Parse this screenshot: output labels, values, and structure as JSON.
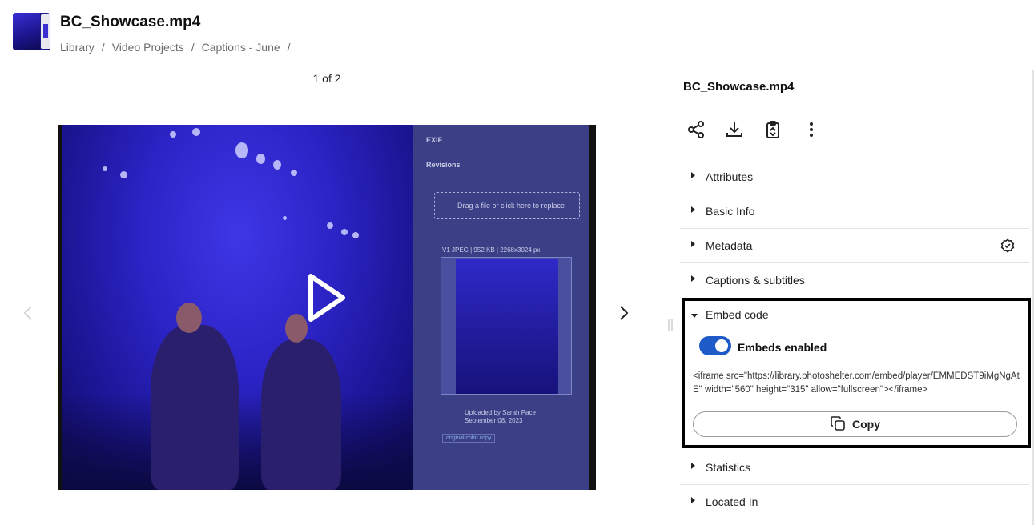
{
  "header": {
    "title": "BC_Showcase.mp4",
    "breadcrumb": [
      "Library",
      "Video Projects",
      "Captions - June"
    ],
    "separator": "/"
  },
  "viewer": {
    "counter": "1 of 2",
    "side_panel": {
      "exif": "EXIF",
      "revisions": "Revisions",
      "drop_text": "Drag a file or click here to replace",
      "version_meta": "V1  JPEG | 952 KB | 2268x3024 px",
      "uploaded_by": "Uploaded by Sarah Pace",
      "upload_date": "September 08, 2023",
      "tag": "original color copy"
    }
  },
  "panel": {
    "title": "BC_Showcase.mp4",
    "actions": [
      "share-icon",
      "download-icon",
      "clipboard-copy-icon",
      "more-vertical-icon"
    ],
    "sections": [
      "Attributes",
      "Basic Info",
      "Metadata",
      "Captions & subtitles"
    ],
    "embed": {
      "label": "Embed code",
      "toggle_label": "Embeds enabled",
      "toggle_on": true,
      "code": "<iframe src=\"https://library.photoshelter.com/embed/player/EMMEDST9iMgNgAtE\" width=\"560\" height=\"315\" allow=\"fullscreen\"></iframe>",
      "copy_label": "Copy"
    },
    "sections_after": [
      "Statistics",
      "Located In"
    ]
  },
  "colors": {
    "accent": "#1f5bc8",
    "overlay": "#2b23c4"
  }
}
